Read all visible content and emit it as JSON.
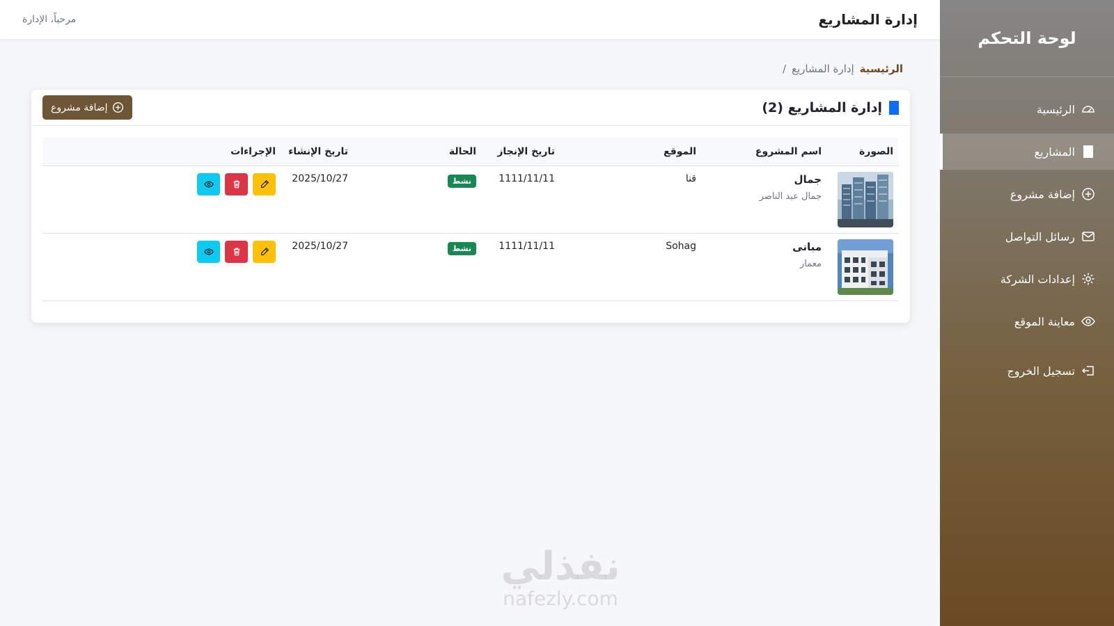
{
  "sidebar": {
    "brand": "لوحة التحكم",
    "items": [
      {
        "label": "الرئيسية",
        "icon": "speedometer-icon"
      },
      {
        "label": "المشاريع",
        "icon": "square-icon"
      },
      {
        "label": "إضافة مشروع",
        "icon": "plus-circle-icon"
      },
      {
        "label": "رسائل التواصل",
        "icon": "envelope-icon"
      },
      {
        "label": "إعدادات الشركة",
        "icon": "gear-icon"
      },
      {
        "label": "معاينة الموقع",
        "icon": "eye-icon"
      },
      {
        "label": "تسجيل الخروج",
        "icon": "logout-icon"
      }
    ]
  },
  "topbar": {
    "title": "إدارة المشاريع",
    "welcome": "مرحباً، الإدارة"
  },
  "breadcrumb": {
    "home": "الرئيسية",
    "separator": "/",
    "current": "إدارة المشاريع"
  },
  "card": {
    "title": "إدارة المشاريع (2)",
    "add_button": "إضافة مشروع"
  },
  "table": {
    "headers": [
      "الصورة",
      "اسم المشروع",
      "الموقع",
      "تاريخ الإنجاز",
      "الحالة",
      "تاريخ الإنشاء",
      "الإجراءات"
    ],
    "rows": [
      {
        "name": "جمال",
        "description": "جمال عبد الناصر",
        "location": "قنا",
        "completion_date": "1111/11/11",
        "status": "نشط",
        "created_at": "2025/10/27"
      },
      {
        "name": "مبانى",
        "description": "معمار",
        "location": "Sohag",
        "completion_date": "1111/11/11",
        "status": "نشط",
        "created_at": "2025/10/27"
      }
    ]
  },
  "watermark": {
    "arabic": "نفذلي",
    "latin": "nafezly.com"
  },
  "colors": {
    "accent_brown": "#6e5535",
    "primary_blue": "#0d6efd",
    "status_green": "#198754",
    "edit_yellow": "#ffc107",
    "delete_red": "#dc3545",
    "view_cyan": "#0dcaf0"
  }
}
